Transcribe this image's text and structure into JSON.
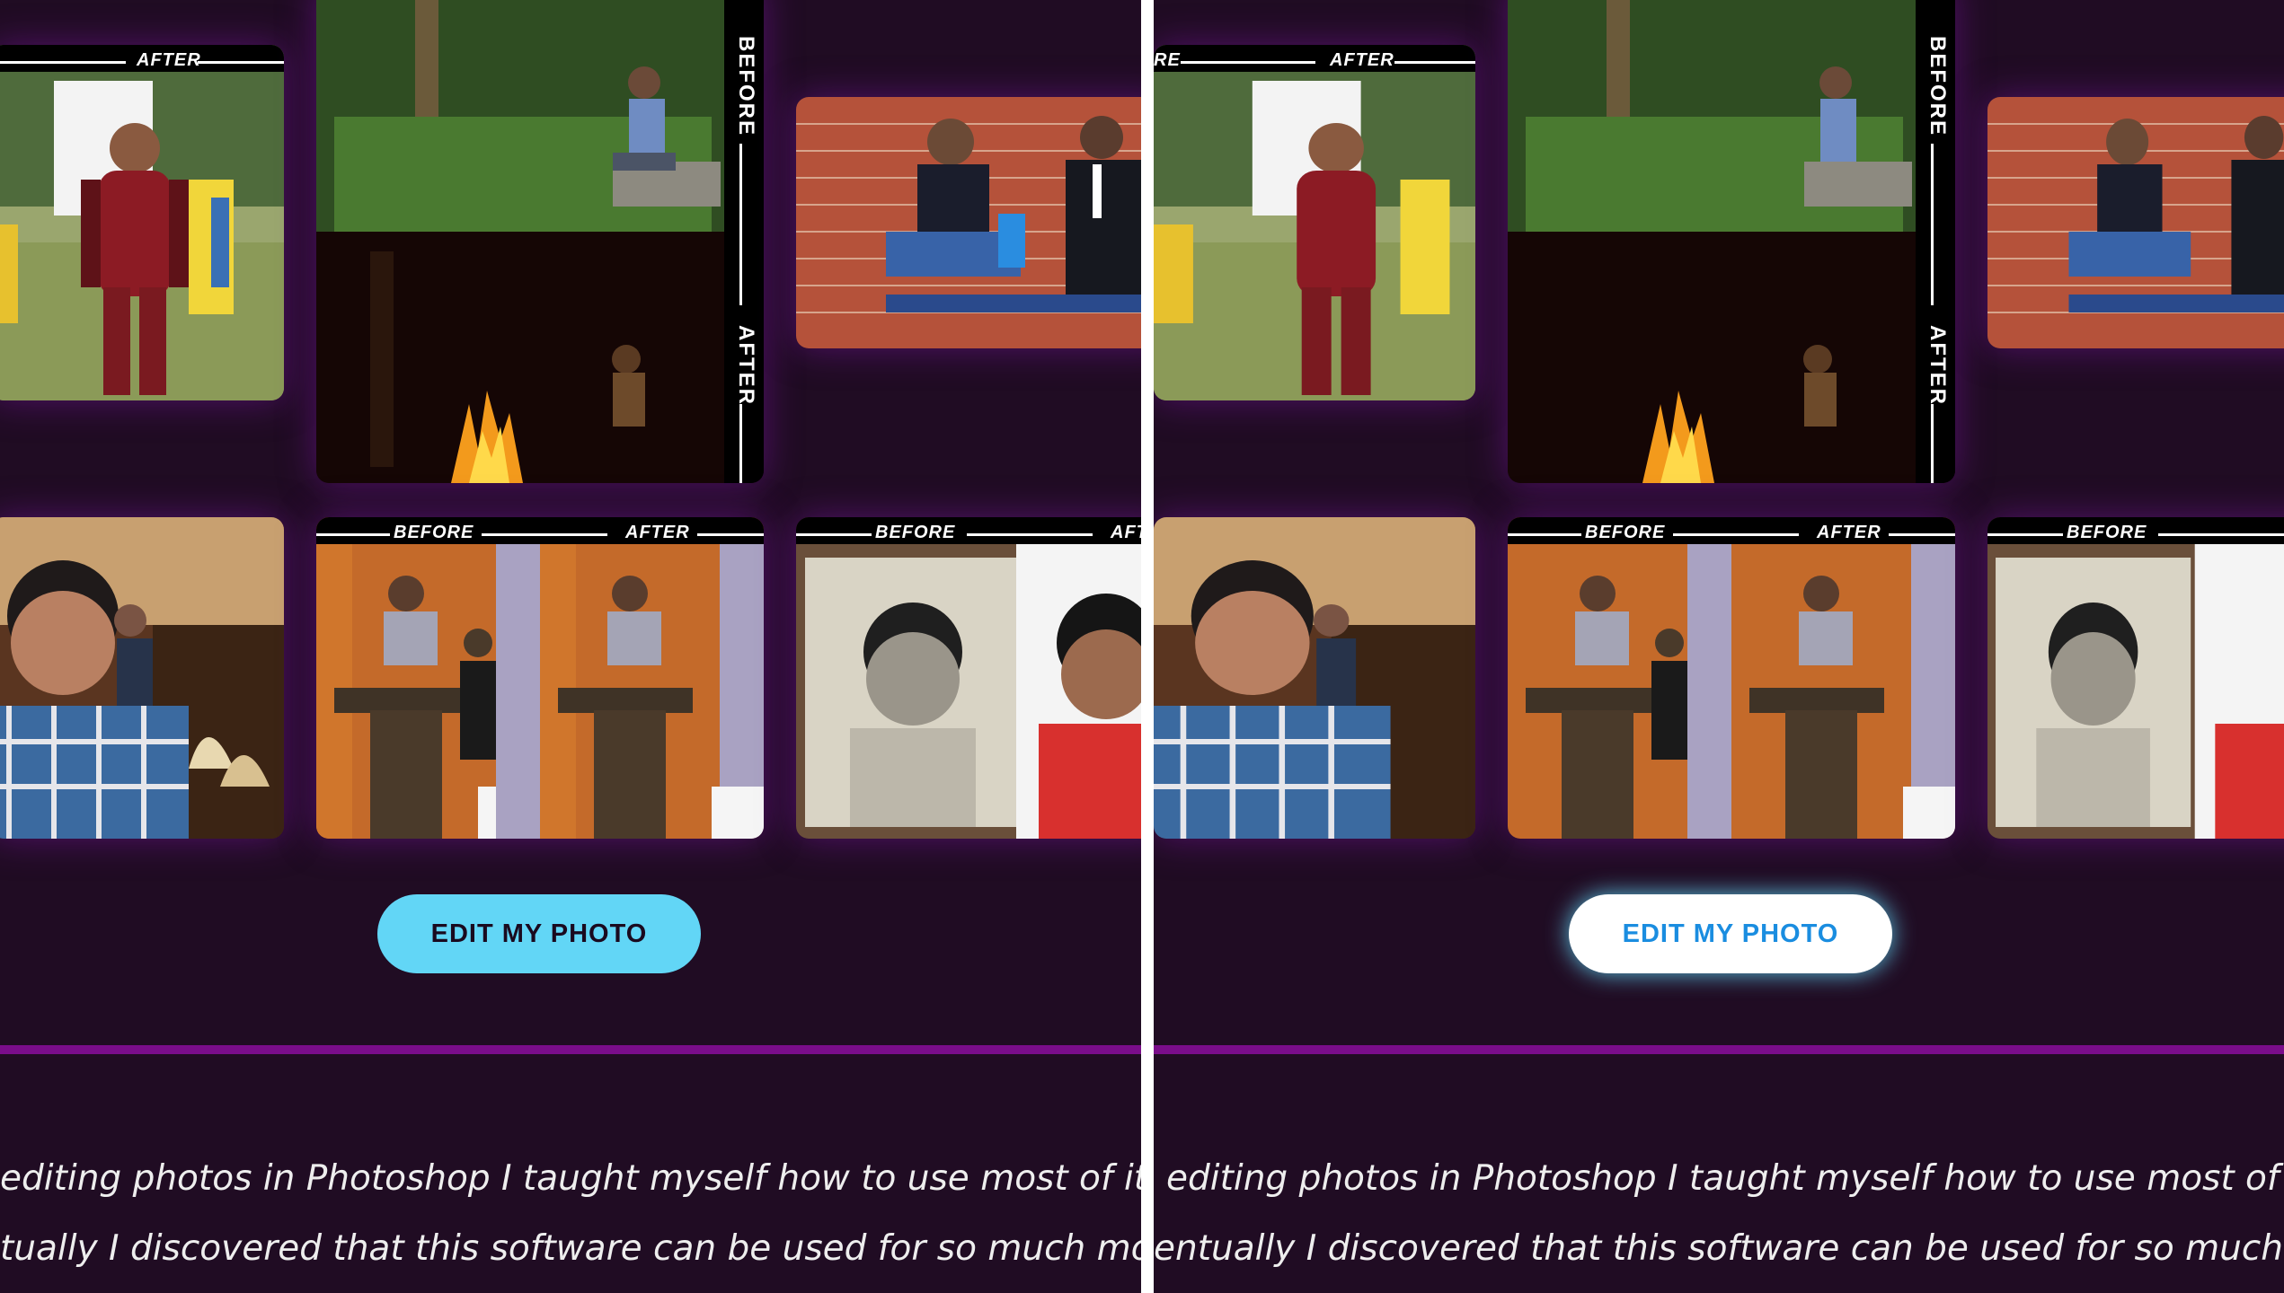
{
  "labels": {
    "before": "BEFORE",
    "after": "AFTER",
    "after_partial": "AFT",
    "before_partial_left": "RE"
  },
  "cta": {
    "label": "EDIT MY PHOTO"
  },
  "marquee": {
    "left_line1": "editing photos in Photoshop I taught myself how to use most of its t",
    "left_line2": "tually I discovered that this software can be used for so much more",
    "right_line1": "editing photos in Photoshop I taught myself how to use most of i",
    "right_line2": "entually I discovered that this software can be used for so much m"
  },
  "colors": {
    "background": "#200c23",
    "accent_purple": "#7a0d8a",
    "button_default": "#62d6f6",
    "button_hover_text": "#1a8de0"
  },
  "icons": [
    "photo-deadpool",
    "photo-forest-campfire",
    "photo-brick-wall-bench",
    "photo-restaurant-portrait",
    "photo-podium-speaker",
    "photo-vintage-restoration"
  ]
}
